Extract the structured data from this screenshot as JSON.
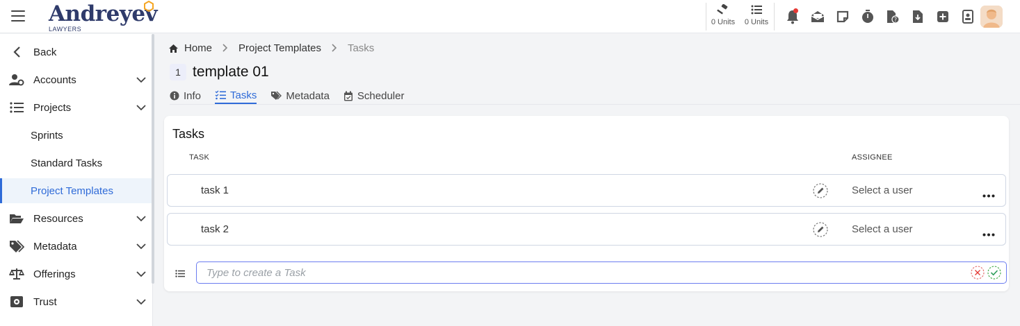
{
  "header": {
    "logo_main": "Andreyev",
    "logo_sub": "LAWYERS",
    "units": [
      {
        "icon": "gavel-icon",
        "label": "0 Units"
      },
      {
        "icon": "list-icon",
        "label": "0 Units"
      }
    ],
    "icons": [
      "bell-icon",
      "mail-open-icon",
      "sticky-note-icon",
      "stopwatch-icon",
      "file-question-icon",
      "file-download-icon",
      "plus-square-icon",
      "id-badge-icon"
    ],
    "accent_color": "#2f6bd8",
    "notification_color": "#e53935"
  },
  "sidebar": {
    "items": [
      {
        "label": "Back",
        "icon": "chevron-left-icon"
      },
      {
        "label": "Accounts",
        "icon": "user-cog-icon"
      },
      {
        "label": "Projects",
        "icon": "list-icon"
      },
      {
        "label": "Sprints"
      },
      {
        "label": "Standard Tasks"
      },
      {
        "label": "Project Templates",
        "active": true
      },
      {
        "label": "Resources",
        "icon": "folder-open-icon"
      },
      {
        "label": "Metadata",
        "icon": "tags-icon"
      },
      {
        "label": "Offerings",
        "icon": "scale-icon"
      },
      {
        "label": "Trust",
        "icon": "vault-icon"
      }
    ]
  },
  "breadcrumb": {
    "home": "Home",
    "parent": "Project Templates",
    "current": "Tasks"
  },
  "page": {
    "id": "1",
    "title": "template 01"
  },
  "tabs": [
    {
      "label": "Info",
      "icon": "info-circle-icon"
    },
    {
      "label": "Tasks",
      "icon": "checklist-icon",
      "active": true
    },
    {
      "label": "Metadata",
      "icon": "tags-icon"
    },
    {
      "label": "Scheduler",
      "icon": "calendar-check-icon"
    }
  ],
  "tasks_card": {
    "title": "Tasks",
    "col_task": "TASK",
    "col_assignee": "ASSIGNEE",
    "rows": [
      {
        "name": "task 1",
        "assignee": "Select a user"
      },
      {
        "name": "task 2",
        "assignee": "Select a user"
      }
    ],
    "new_task_placeholder": "Type to create a Task"
  }
}
